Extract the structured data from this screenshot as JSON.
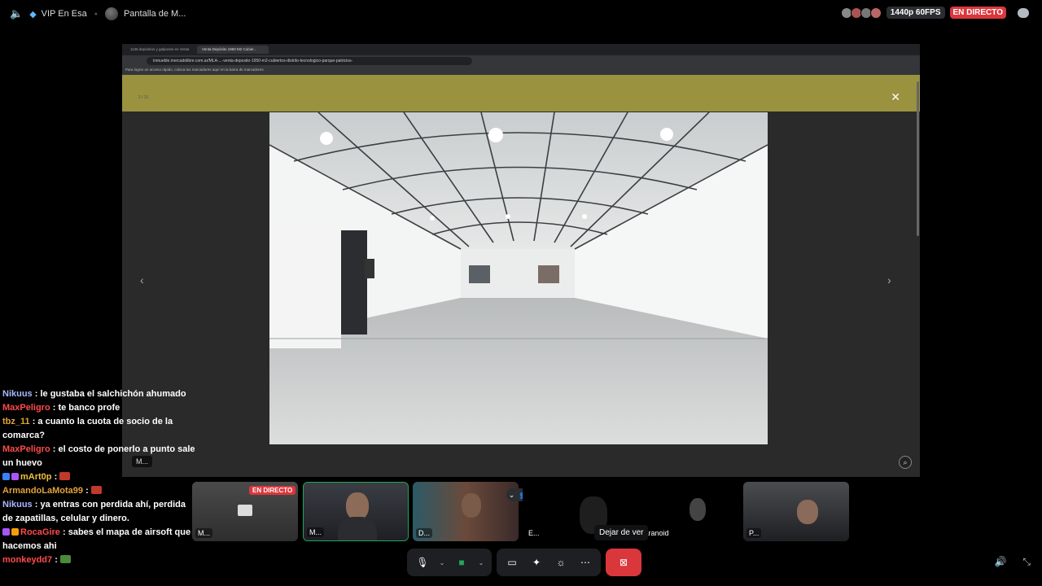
{
  "header": {
    "vip_title": "VIP En Esa",
    "channel_title": "Pantalla de M...",
    "quality": "1440p 60FPS",
    "live_badge": "EN DIRECTO"
  },
  "stream": {
    "tabs": [
      "1136 depósitos y galpones en Venta",
      "Venta Depósito 1950 M2 Cubier..."
    ],
    "url": "inmueble.mercadolibre.com.ar/MLA-...-venta-deposito-1950-m2-cubiertos-distrito-tecnologico-parque-patricios-",
    "bookmark_bar": "Para lograr un acceso rápido, coloca tus marcadores aquí en la barra de marcadores.",
    "counter": "2 / 31",
    "overlay_label": "M..."
  },
  "chat": {
    "messages": [
      {
        "user": "Nikuus",
        "color": "#a9b8ff",
        "text": "le gustaba el salchichón ahumado"
      },
      {
        "user": "MaxPeligro",
        "color": "#ff4b4b",
        "text": "te banco profe"
      },
      {
        "user": "tbz_11",
        "color": "#e0a33a",
        "text": "a cuanto la cuota de socio de la comarca?"
      },
      {
        "user": "MaxPeligro",
        "color": "#ff4b4b",
        "text": "el costo de ponerlo a punto sale un huevo"
      },
      {
        "user": "mArt0p",
        "color": "#f0c040",
        "text": "",
        "badges": [
          "#3b82f6",
          "#a855f7"
        ],
        "emote": "#c0392b"
      },
      {
        "user": "ArmandoLaMota99",
        "color": "#e0a33a",
        "text": "",
        "emote": "#c0392b"
      },
      {
        "user": "Nikuus",
        "color": "#a9b8ff",
        "text": "ya entras con perdida ahí, perdida de zapatillas, celular y dinero."
      },
      {
        "user": "RocaGire",
        "color": "#ff4b4b",
        "text": "sabes el mapa de airsoft que hacemos ahi",
        "badges": [
          "#a855f7",
          "#f59e0b"
        ]
      },
      {
        "user": "monkeydd7",
        "color": "#ff4b4b",
        "text": "",
        "emote": "#4a8a3a"
      }
    ]
  },
  "participants": [
    {
      "name": "M...",
      "live": "EN DIRECTO"
    },
    {
      "name": "M..."
    },
    {
      "name": "D..."
    },
    {
      "name": "E..."
    },
    {
      "name": "...aranoid"
    },
    {
      "name": "P..."
    }
  ],
  "tooltip": "Dejar de ver",
  "colors": {
    "live": "#da373c",
    "speaking": "#23a559"
  }
}
